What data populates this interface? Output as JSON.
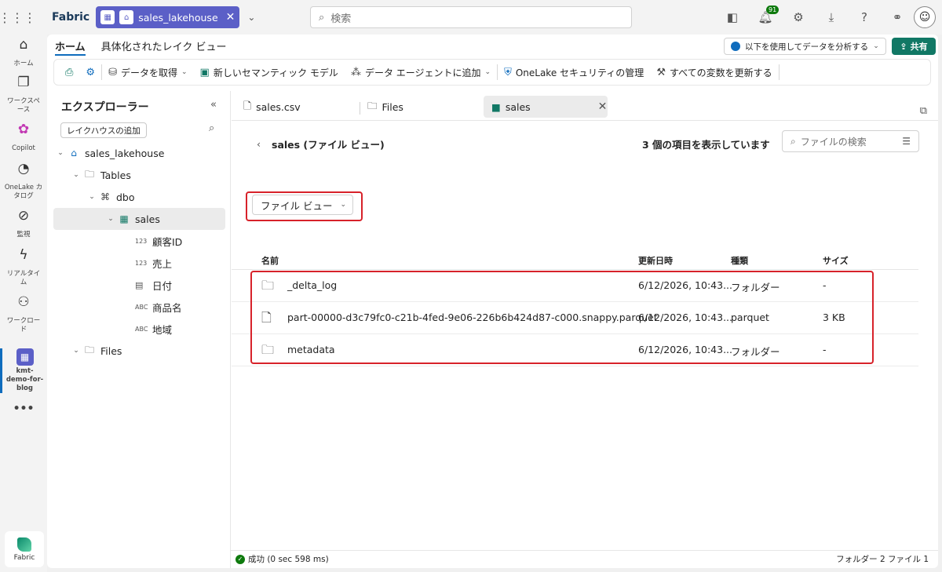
{
  "topbar": {
    "brand": "Fabric",
    "workspace_tab": "sales_lakehouse",
    "search_placeholder": "検索",
    "notification_count": "91"
  },
  "leftnav": {
    "items": [
      {
        "label": "ホーム",
        "icon": "home-icon"
      },
      {
        "label": "ワークスペース",
        "icon": "workspaces-icon"
      },
      {
        "label": "Copilot",
        "icon": "copilot-icon"
      },
      {
        "label": "OneLake カタログ",
        "icon": "onelake-icon"
      },
      {
        "label": "監視",
        "icon": "monitor-icon"
      },
      {
        "label": "リアルタイム",
        "icon": "realtime-icon"
      },
      {
        "label": "ワークロード",
        "icon": "workload-icon"
      },
      {
        "label": "kmt-demo-for-blog",
        "icon": "workspace-icon"
      }
    ],
    "more": "•••",
    "fabric_label": "Fabric"
  },
  "ribbon": {
    "tabs": [
      "ホーム",
      "具体化されたレイク ビュー"
    ],
    "analyze_label": "以下を使用してデータを分析する",
    "share_label": "共有",
    "toolbar": {
      "get_data": "データを取得",
      "semantic_model": "新しいセマンティック モデル",
      "data_agent": "データ エージェントに追加",
      "onelake_security": "OneLake セキュリティの管理",
      "update_vars": "すべての変数を更新する"
    }
  },
  "explorer": {
    "title": "エクスプローラー",
    "add_lakehouse": "レイクハウスの追加",
    "tree": {
      "lakehouse": "sales_lakehouse",
      "tables": "Tables",
      "dbo": "dbo",
      "sales": "sales",
      "columns": [
        {
          "type": "123",
          "name": "顧客ID"
        },
        {
          "type": "123",
          "name": "売上"
        },
        {
          "type": "cal",
          "name": "日付"
        },
        {
          "type": "ABC",
          "name": "商品名"
        },
        {
          "type": "ABC",
          "name": "地域"
        }
      ],
      "files": "Files"
    }
  },
  "content": {
    "tabs": [
      "sales.csv",
      "Files",
      "sales"
    ],
    "breadcrumb": "sales (ファイル ビュー)",
    "item_count": "3 個の項目を表示しています",
    "file_search_placeholder": "ファイルの検索",
    "view_button": "ファイル ビュー",
    "columns": [
      "名前",
      "更新日時",
      "種類",
      "サイズ"
    ],
    "rows": [
      {
        "icon": "folder-icon",
        "name": "_delta_log",
        "modified": "6/12/2026, 10:43...",
        "type": "フォルダー",
        "size": "-"
      },
      {
        "icon": "file-icon",
        "name": "part-00000-d3c79fc0-c21b-4fed-9e06-226b6b424d87-c000.snappy.parquet",
        "modified": "6/12/2026, 10:43...",
        "type": "parquet",
        "size": "3 KB"
      },
      {
        "icon": "folder-icon",
        "name": "metadata",
        "modified": "6/12/2026, 10:43...",
        "type": "フォルダー",
        "size": "-"
      }
    ]
  },
  "status": {
    "success": "成功 (0 sec 598 ms)",
    "summary": "フォルダー 2 ファイル 1"
  },
  "colors": {
    "accent": "#0f6cbd",
    "workspace_pill": "#5b5fc7",
    "share": "#117865",
    "highlight": "#d7222a"
  }
}
